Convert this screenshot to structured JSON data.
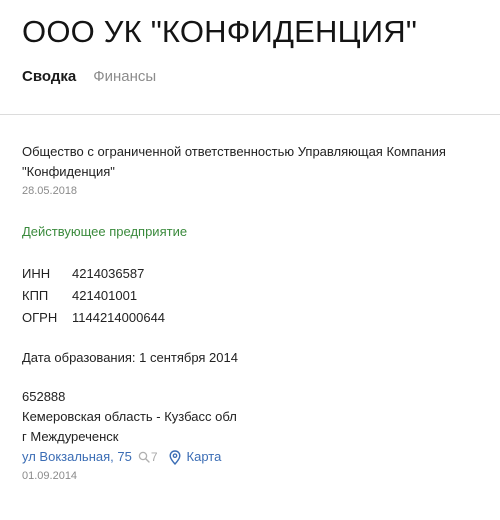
{
  "header": {
    "title": "ООО УК \"КОНФИДЕНЦИЯ\"",
    "tabs": [
      {
        "label": "Сводка",
        "active": true
      },
      {
        "label": "Финансы",
        "active": false
      }
    ]
  },
  "company": {
    "full_name": "Общество с ограниченной ответственностью Управляющая Компания \"Конфиденция\"",
    "name_date": "28.05.2018",
    "status": "Действующее предприятие",
    "codes": [
      {
        "label": "ИНН",
        "value": "4214036587"
      },
      {
        "label": "КПП",
        "value": "421401001"
      },
      {
        "label": "ОГРН",
        "value": "1144214000644"
      }
    ],
    "founded": "Дата образования: 1 сентября 2014"
  },
  "address": {
    "postal_code": "652888",
    "region": "Кемеровская область - Кузбасс обл",
    "city": "г Междуреченск",
    "street": "ул Вокзальная, 75",
    "search_count": "7",
    "map_label": "Карта",
    "date": "01.09.2014"
  },
  "colors": {
    "status": "#3a8a3c",
    "link": "#3b6db5",
    "muted": "#8a8a8a"
  },
  "icons": {
    "search": "search-icon",
    "map": "map-pin-icon"
  }
}
